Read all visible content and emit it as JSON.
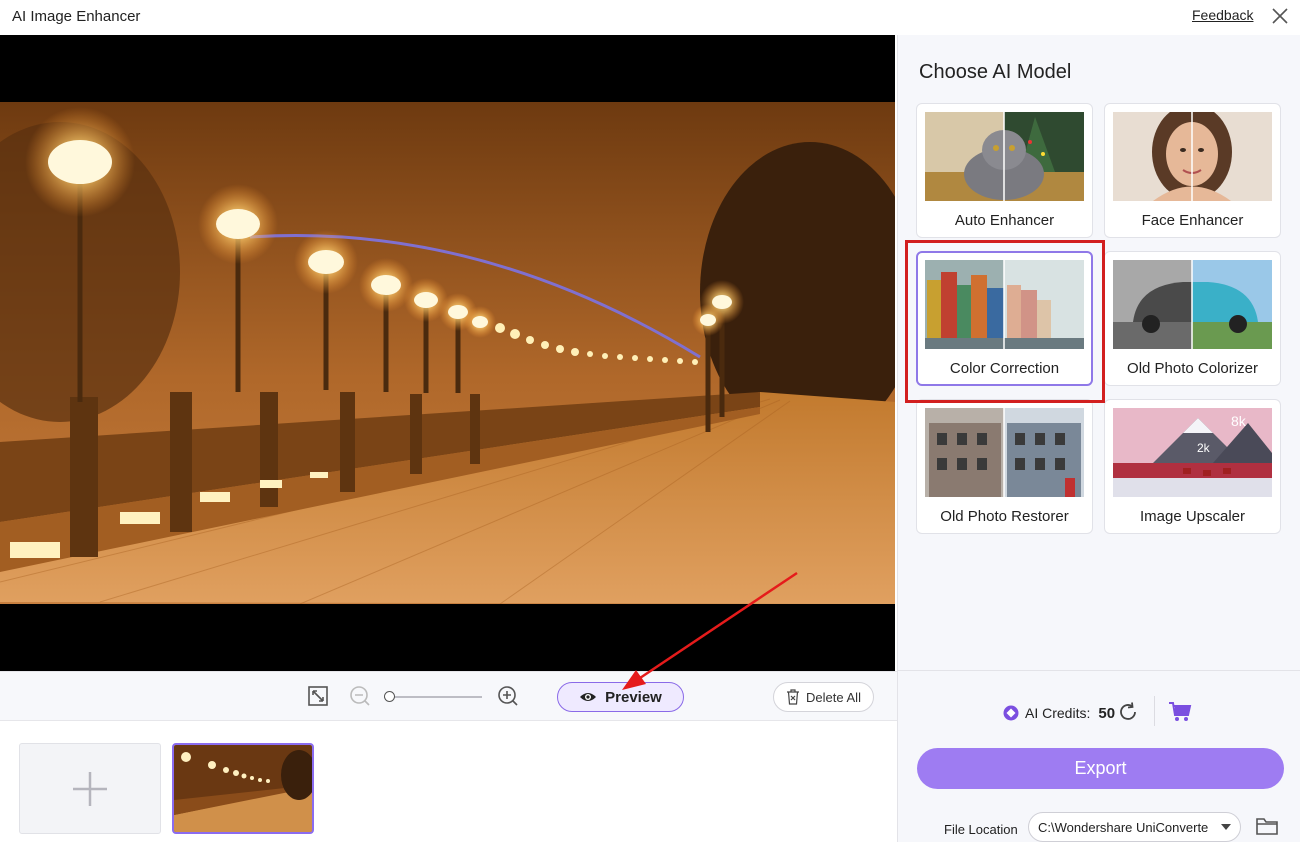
{
  "titlebar": {
    "title": "AI Image Enhancer",
    "feedback": "Feedback"
  },
  "toolbar": {
    "preview": "Preview",
    "delete_all": "Delete All"
  },
  "panel": {
    "title": "Choose AI Model",
    "models": [
      {
        "label": "Auto Enhancer"
      },
      {
        "label": "Face Enhancer"
      },
      {
        "label": "Color Correction",
        "selected": true
      },
      {
        "label": "Old Photo Colorizer"
      },
      {
        "label": "Old Photo Restorer"
      },
      {
        "label": "Image Upscaler"
      }
    ],
    "upscaler_badges": {
      "big": "8k",
      "small": "2k"
    }
  },
  "credits": {
    "label": "AI Credits:",
    "value": "50"
  },
  "export": {
    "label": "Export"
  },
  "file_location": {
    "label": "File Location",
    "value": "C:\\Wondershare UniConverte"
  },
  "colors": {
    "accent": "#9e7cf2",
    "highlight": "#d21f1f"
  },
  "icons": [
    "close-icon",
    "fit-screen-icon",
    "zoom-out-icon",
    "zoom-in-icon",
    "eye-icon",
    "trash-icon",
    "plus-icon",
    "ai-credits-icon",
    "refresh-icon",
    "cart-icon",
    "chevron-down-icon",
    "folder-icon"
  ]
}
